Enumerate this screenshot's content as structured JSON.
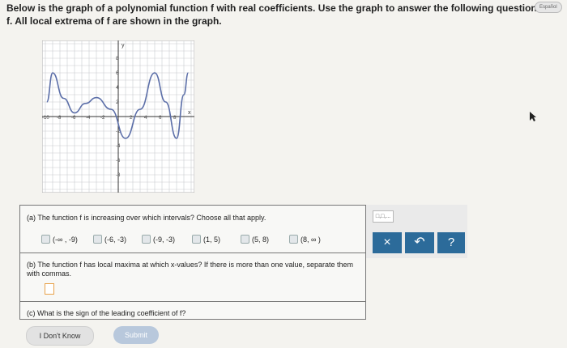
{
  "header": {
    "line1": "Below is the graph of a polynomial function f with real coefficients. Use the graph to answer the following questions ab",
    "line2": "f. All local extrema of f are shown in the graph.",
    "lang_button": "Español"
  },
  "graph": {
    "x_axis_label": "x",
    "y_axis_label": "y",
    "x_tick_labels": [
      "-10",
      "-8",
      "-6",
      "-4",
      "-2",
      "2",
      "4",
      "6",
      "8"
    ],
    "y_tick_labels": [
      "8",
      "6",
      "4",
      "2",
      "-2",
      "-4",
      "-6",
      "-8"
    ],
    "curve_color": "#5b6ea8"
  },
  "question_a": {
    "text": "(a) The function f is increasing over which intervals? Choose all that apply.",
    "choices": [
      "(-∞ , -9)",
      "(-6, -3)",
      "(-9, -3)",
      "(1, 5)",
      "(5, 8)",
      "(8, ∞ )"
    ]
  },
  "question_b": {
    "text": "(b) The function f has local maxima at which x-values? If there is more than one value, separate them with commas."
  },
  "question_c": {
    "text": "(c) What is the sign of the leading coefficient of f?"
  },
  "tools": {
    "format_label": "□,□,...",
    "clear_symbol": "×",
    "undo_symbol": "↶",
    "help_symbol": "?"
  },
  "buttons": {
    "dont_know": "I Don't Know",
    "submit": "Submit"
  },
  "colors": {
    "accent": "#2c6b9a",
    "submit_bg": "#b8c8dc",
    "answer_border": "#e8a24a"
  }
}
